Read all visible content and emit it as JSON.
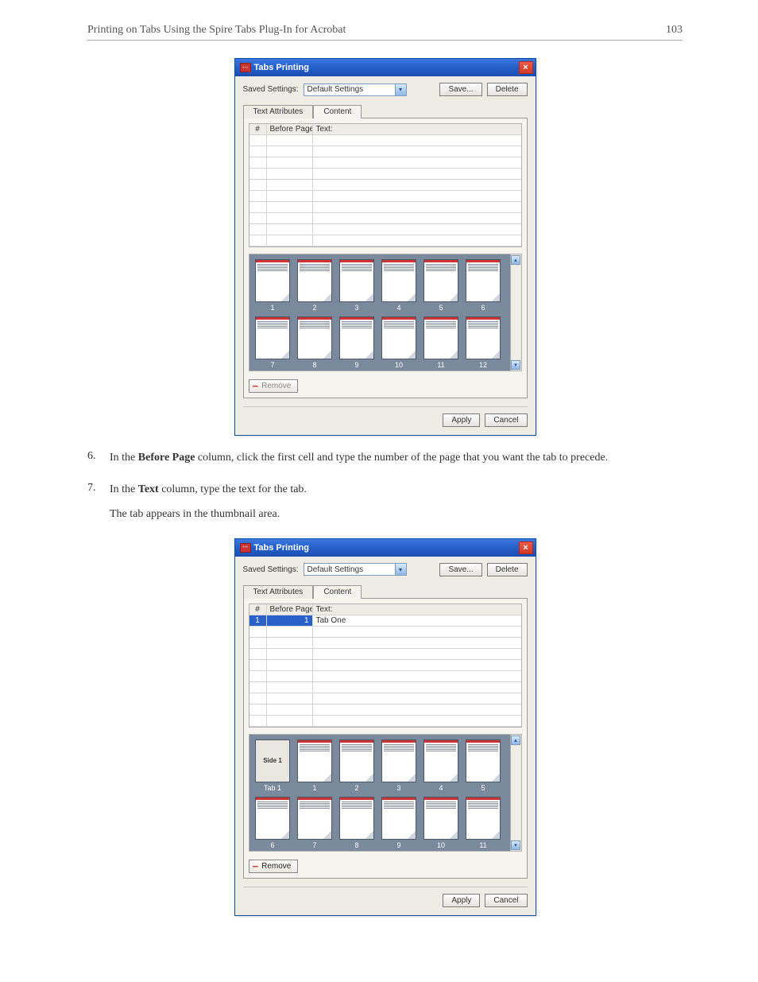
{
  "header": {
    "title": "Printing on Tabs Using the Spire Tabs Plug-In for Acrobat",
    "page_number": "103"
  },
  "steps": [
    {
      "num": "6.",
      "body_parts": [
        {
          "t": "text",
          "v": "In the "
        },
        {
          "t": "bold",
          "v": "Before Page"
        },
        {
          "t": "text",
          "v": " column, click the first cell and type the number of the page that you want the tab to precede."
        }
      ]
    },
    {
      "num": "7.",
      "body_parts": [
        {
          "t": "text",
          "v": "In the "
        },
        {
          "t": "bold",
          "v": "Text"
        },
        {
          "t": "text",
          "v": " column, type the text for the tab."
        }
      ],
      "followup": "The tab appears in the thumbnail area."
    }
  ],
  "dialog1": {
    "title": "Tabs Printing",
    "saved_label": "Saved Settings:",
    "saved_value": "Default Settings",
    "save_btn": "Save...",
    "delete_btn": "Delete",
    "tab_attrs": "Text Attributes",
    "tab_content": "Content",
    "cols": {
      "n": "#",
      "before": "Before Page",
      "text": "Text:"
    },
    "rows": [
      {
        "n": "",
        "before": "",
        "text": ""
      },
      {
        "n": "",
        "before": "",
        "text": ""
      },
      {
        "n": "",
        "before": "",
        "text": ""
      },
      {
        "n": "",
        "before": "",
        "text": ""
      },
      {
        "n": "",
        "before": "",
        "text": ""
      },
      {
        "n": "",
        "before": "",
        "text": ""
      },
      {
        "n": "",
        "before": "",
        "text": ""
      },
      {
        "n": "",
        "before": "",
        "text": ""
      },
      {
        "n": "",
        "before": "",
        "text": ""
      },
      {
        "n": "",
        "before": "",
        "text": ""
      }
    ],
    "thumbs": [
      "1",
      "2",
      "3",
      "4",
      "5",
      "6",
      "7",
      "8",
      "9",
      "10",
      "11",
      "12"
    ],
    "remove": "Remove",
    "apply": "Apply",
    "cancel": "Cancel"
  },
  "dialog2": {
    "title": "Tabs Printing",
    "saved_label": "Saved Settings:",
    "saved_value": "Default Settings",
    "save_btn": "Save...",
    "delete_btn": "Delete",
    "tab_attrs": "Text Attributes",
    "tab_content": "Content",
    "cols": {
      "n": "#",
      "before": "Before Page",
      "text": "Text:"
    },
    "rows": [
      {
        "n": "1",
        "before": "1",
        "text": "Tab One",
        "selected": true
      },
      {
        "n": "",
        "before": "",
        "text": ""
      },
      {
        "n": "",
        "before": "",
        "text": ""
      },
      {
        "n": "",
        "before": "",
        "text": ""
      },
      {
        "n": "",
        "before": "",
        "text": ""
      },
      {
        "n": "",
        "before": "",
        "text": ""
      },
      {
        "n": "",
        "before": "",
        "text": ""
      },
      {
        "n": "",
        "before": "",
        "text": ""
      },
      {
        "n": "",
        "before": "",
        "text": ""
      },
      {
        "n": "",
        "before": "",
        "text": ""
      }
    ],
    "tab_thumb": {
      "side": "Side 1",
      "label": "Tab 1"
    },
    "thumbs": [
      "1",
      "2",
      "3",
      "4",
      "5",
      "6",
      "7",
      "8",
      "9",
      "10",
      "11"
    ],
    "remove": "Remove",
    "apply": "Apply",
    "cancel": "Cancel"
  }
}
